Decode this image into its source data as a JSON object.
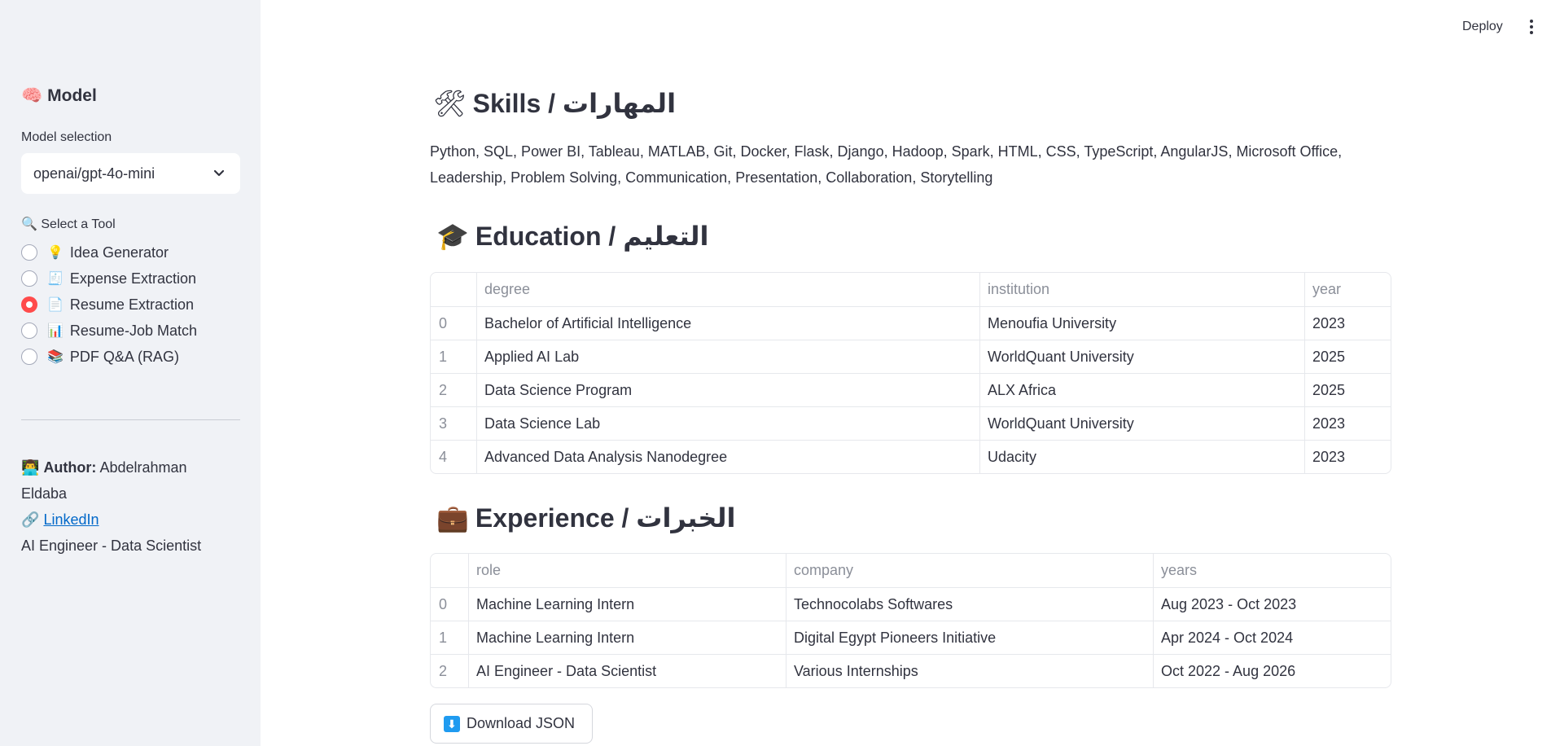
{
  "header": {
    "deploy_label": "Deploy"
  },
  "sidebar": {
    "model_heading": "Model",
    "model_emoji": "🧠",
    "model_selection_label": "Model selection",
    "model_selected": "openai/gpt-4o-mini",
    "tool_label": "🔍 Select a Tool",
    "tools": [
      {
        "emoji": "💡",
        "label": "Idea Generator",
        "selected": false
      },
      {
        "emoji": "🧾",
        "label": "Expense Extraction",
        "selected": false
      },
      {
        "emoji": "📄",
        "label": "Resume Extraction",
        "selected": true
      },
      {
        "emoji": "📊",
        "label": "Resume-Job Match",
        "selected": false
      },
      {
        "emoji": "📚",
        "label": "PDF Q&A (RAG)",
        "selected": false
      }
    ],
    "author_emoji": "👨‍💻",
    "author_label": "Author:",
    "author_name": "Abdelrahman Eldaba",
    "link_emoji": "🔗",
    "link_label": "LinkedIn",
    "author_title": "AI Engineer - Data Scientist"
  },
  "skills": {
    "emoji": "🛠",
    "title": "Skills / المهارات",
    "text": "Python, SQL, Power BI, Tableau, MATLAB, Git, Docker, Flask, Django, Hadoop, Spark, HTML, CSS, TypeScript, AngularJS, Microsoft Office, Leadership, Problem Solving, Communication, Presentation, Collaboration, Storytelling"
  },
  "education": {
    "emoji": "🎓",
    "title": "Education / التعليم",
    "columns": [
      "degree",
      "institution",
      "year"
    ],
    "rows": [
      {
        "idx": "0",
        "degree": "Bachelor of Artificial Intelligence",
        "institution": "Menoufia University",
        "year": "2023"
      },
      {
        "idx": "1",
        "degree": "Applied AI Lab",
        "institution": "WorldQuant University",
        "year": "2025"
      },
      {
        "idx": "2",
        "degree": "Data Science Program",
        "institution": "ALX Africa",
        "year": "2025"
      },
      {
        "idx": "3",
        "degree": "Data Science Lab",
        "institution": "WorldQuant University",
        "year": "2023"
      },
      {
        "idx": "4",
        "degree": "Advanced Data Analysis Nanodegree",
        "institution": "Udacity",
        "year": "2023"
      }
    ]
  },
  "experience": {
    "emoji": "💼",
    "title": "Experience / الخبرات",
    "columns": [
      "role",
      "company",
      "years"
    ],
    "rows": [
      {
        "idx": "0",
        "role": "Machine Learning Intern",
        "company": "Technocolabs Softwares",
        "years": "Aug 2023 - Oct 2023"
      },
      {
        "idx": "1",
        "role": "Machine Learning Intern",
        "company": "Digital Egypt Pioneers Initiative",
        "years": "Apr 2024 - Oct 2024"
      },
      {
        "idx": "2",
        "role": "AI Engineer - Data Scientist",
        "company": "Various Internships",
        "years": "Oct 2022 - Aug 2026"
      }
    ]
  },
  "download": {
    "icon": "⬇",
    "label": "Download JSON"
  }
}
